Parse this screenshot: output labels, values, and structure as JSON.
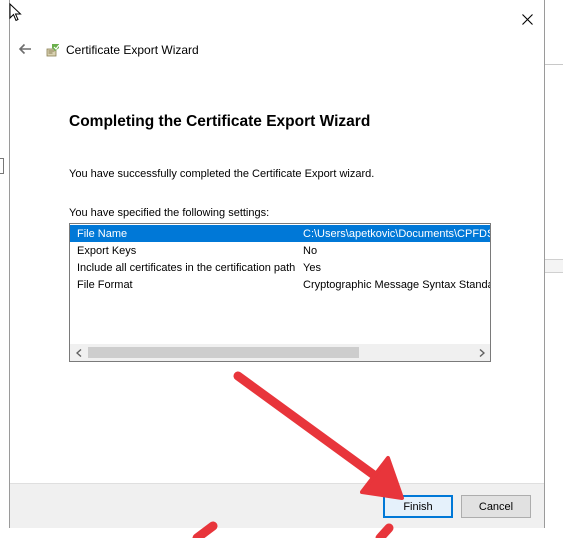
{
  "window": {
    "title": "Certificate Export Wizard"
  },
  "icons": {
    "back": "back-arrow-icon",
    "close": "close-icon",
    "wizard": "certificate-wizard-icon",
    "cursor": "mouse-cursor-icon"
  },
  "main": {
    "heading": "Completing the Certificate Export Wizard",
    "success_text": "You have successfully completed the Certificate Export wizard.",
    "settings_label": "You have specified the following settings:"
  },
  "settings": [
    {
      "name": "File Name",
      "value": "C:\\Users\\apetkovic\\Documents\\CPFDS"
    },
    {
      "name": "Export Keys",
      "value": "No"
    },
    {
      "name": "Include all certificates in the certification path",
      "value": "Yes"
    },
    {
      "name": "File Format",
      "value": "Cryptographic Message Syntax Standa"
    }
  ],
  "buttons": {
    "finish": "Finish",
    "cancel": "Cancel"
  },
  "colors": {
    "selection": "#0078d7",
    "annotation_arrow": "#e8353b"
  }
}
